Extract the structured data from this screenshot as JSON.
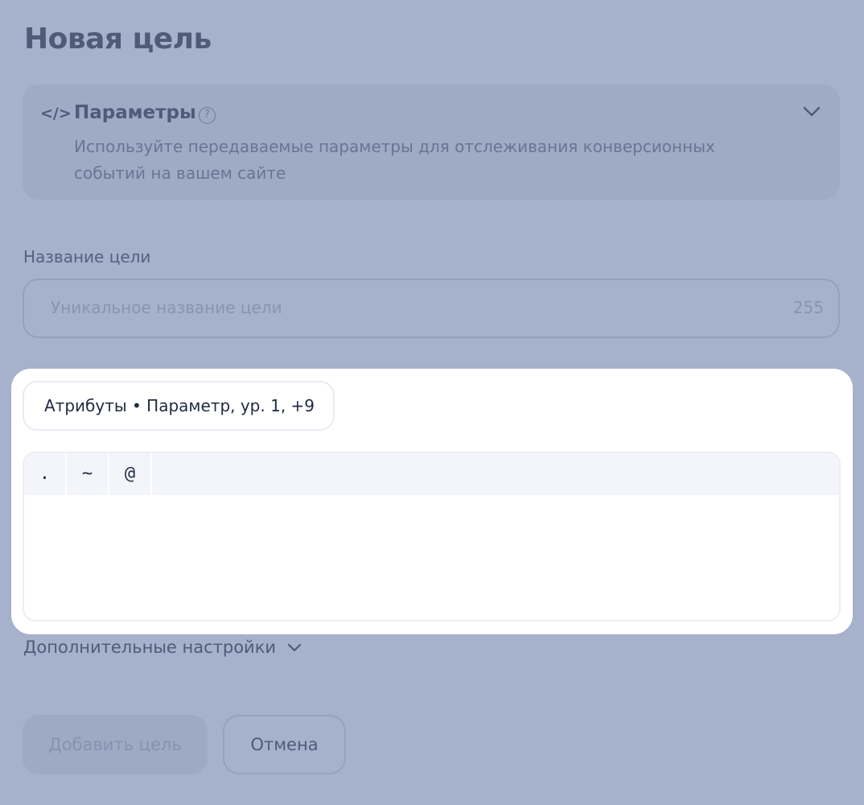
{
  "page": {
    "title": "Новая цель"
  },
  "goal_type": {
    "icon": "code-icon",
    "code_glyph": "</>",
    "title": "Параметры",
    "help_glyph": "?",
    "description": "Используйте передаваемые параметры для отслеживания конверсионных событий на вашем сайте",
    "expand_icon": "chevron-down-icon"
  },
  "goal_name": {
    "label": "Название цели",
    "placeholder": "Уникальное название цели",
    "counter": "255"
  },
  "parameter_editor": {
    "chip_label": "Атрибуты • Параметр, ур. 1, +9",
    "toolbar_symbols": [
      ".",
      "~",
      "@"
    ]
  },
  "advanced": {
    "label": "Дополнительные настройки",
    "icon": "chevron-down-icon"
  },
  "actions": {
    "add_label": "Добавить цель",
    "cancel_label": "Отмена"
  },
  "colors": {
    "overlay_background": "#a6b1cb",
    "highlight_panel": "#ffffff",
    "toolbar_background": "#f4f5fa"
  }
}
